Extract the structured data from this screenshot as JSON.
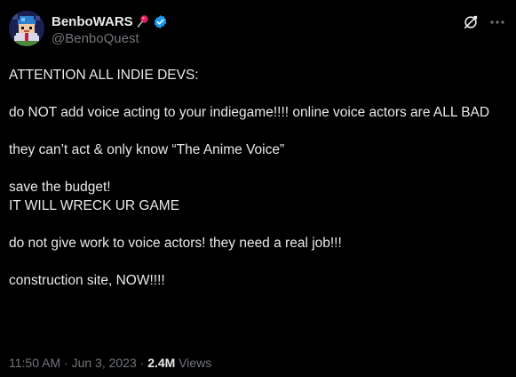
{
  "author": {
    "display_name": "BenboWARS",
    "handle": "@BenboQuest",
    "pin_emoji": "pushpin-icon",
    "verified_badge": "verified-icon",
    "avatar": "pixel-art-avatar"
  },
  "header_actions": {
    "grok_icon": "grok-icon",
    "more_icon": "more-options-icon"
  },
  "post": {
    "paragraphs": [
      "ATTENTION ALL INDIE DEVS:",
      "do NOT add voice acting to your indiegame!!!! online voice actors are ALL BAD",
      "they can’t act & only know “The Anime Voice”",
      "save the budget!\nIT WILL WRECK UR GAME",
      "do not give work to voice actors! they need a real job!!!",
      "construction site, NOW!!!!"
    ]
  },
  "meta": {
    "time": "11:50 AM",
    "separator": " · ",
    "date": "Jun 3, 2023",
    "views_count": "2.4M",
    "views_label": " Views"
  },
  "colors": {
    "background": "#000000",
    "text_primary": "#e7e9ea",
    "text_secondary": "#71767b",
    "verified_blue": "#1d9bf0",
    "pin_red": "#e0245e"
  }
}
